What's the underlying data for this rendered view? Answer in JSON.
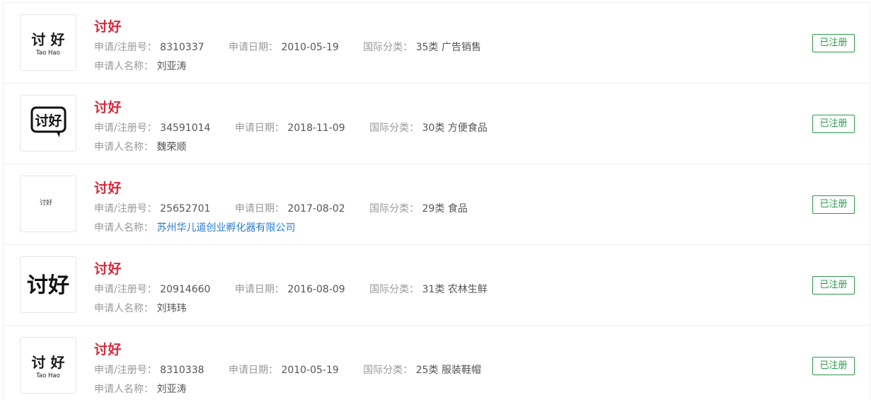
{
  "labels": {
    "reg_no": "申请/注册号：",
    "apply_date": "申请日期：",
    "intl_class": "国际分类：",
    "applicant": "申请人名称："
  },
  "items": [
    {
      "name": "讨好",
      "reg_no": "8310337",
      "apply_date": "2010-05-19",
      "intl_class": "35类 广告销售",
      "applicant": "刘亚涛",
      "status": "已注册",
      "logo": {
        "type": "taohao-cn-pinyin",
        "cn": "讨 好",
        "pinyin": "Tao Hao"
      }
    },
    {
      "name": "讨好",
      "reg_no": "34591014",
      "apply_date": "2018-11-09",
      "intl_class": "30类 方便食品",
      "applicant": "魏荣顺",
      "status": "已注册",
      "logo": {
        "type": "speech-bubble",
        "cn": "讨好"
      }
    },
    {
      "name": "讨好",
      "reg_no": "25652701",
      "apply_date": "2017-08-02",
      "intl_class": "29类 食品",
      "applicant": "苏州华儿道创业孵化器有限公司",
      "status": "已注册",
      "logo": {
        "type": "small-text",
        "cn": "讨好"
      }
    },
    {
      "name": "讨好",
      "reg_no": "20914660",
      "apply_date": "2016-08-09",
      "intl_class": "31类 农林生鲜",
      "applicant": "刘玮玮",
      "status": "已注册",
      "logo": {
        "type": "large-text",
        "cn": "讨好"
      }
    },
    {
      "name": "讨好",
      "reg_no": "8310338",
      "apply_date": "2010-05-19",
      "intl_class": "25类 服装鞋帽",
      "applicant": "刘亚涛",
      "status": "已注册",
      "logo": {
        "type": "taohao-cn-pinyin",
        "cn": "讨 好",
        "pinyin": "Tao Hao"
      }
    }
  ],
  "colors": {
    "name": "#d9283a",
    "status": "#2e9a4e",
    "link": "#2a7bd0",
    "label": "#999999",
    "value": "#555555"
  }
}
